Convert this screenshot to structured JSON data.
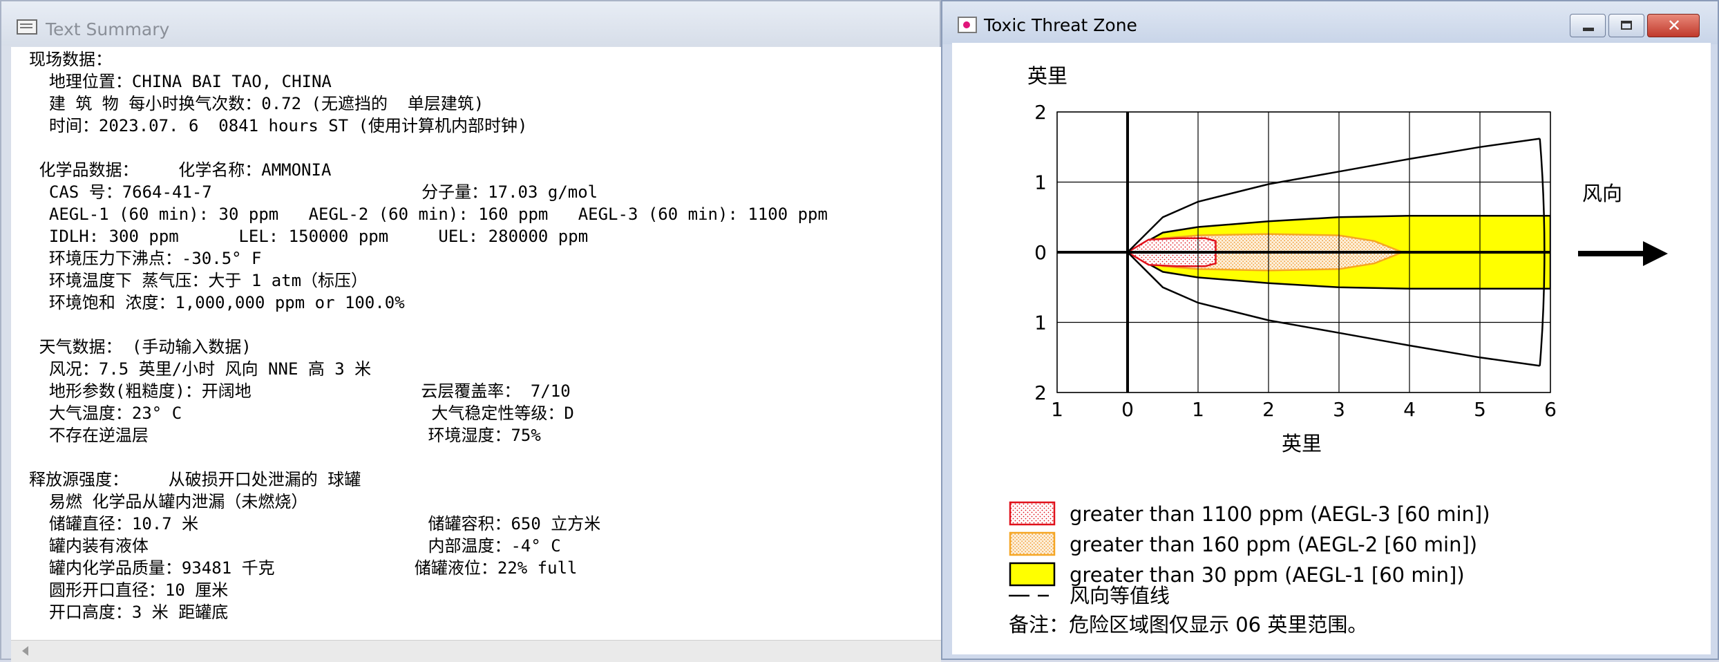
{
  "text_summary": {
    "window_title": "Text Summary",
    "lines": [
      "现场数据：",
      "  地理位置：CHINA BAI TAO, CHINA",
      "  建 筑 物 每小时换气次数：0.72 (无遮挡的  单层建筑)",
      "  时间：2023.07. 6  0841 hours ST (使用计算机内部时钟)",
      "",
      " 化学品数据：    化学名称：AMMONIA",
      "  CAS 号：7664-41-7                     分子量：17.03 g/mol",
      "  AEGL-1 (60 min): 30 ppm   AEGL-2 (60 min): 160 ppm   AEGL-3 (60 min): 1100 ppm",
      "  IDLH: 300 ppm      LEL: 150000 ppm     UEL: 280000 ppm",
      "  环境压力下沸点：-30.5° F",
      "  环境温度下 蒸气压：大于 1 atm（标压）",
      "  环境饱和 浓度：1,000,000 ppm or 100.0%",
      "",
      " 天气数据： (手动输入数据)",
      "  风况：7.5 英里/小时 风向 NNE 高 3 米",
      "  地形参数(粗糙度)：开阔地                 云层覆盖率： 7/10",
      "  大气温度：23° C                         大气稳定性等级：D",
      "  不存在逆温层                            环境湿度：75%",
      "",
      "释放源强度：    从破损开口处泄漏的 球罐",
      "  易燃 化学品从罐内泄漏（未燃烧）",
      "  储罐直径：10.7 米                       储罐容积：650 立方米",
      "  罐内装有液体                            内部温度：-4° C",
      "  罐内化学品质量：93481 千克              储罐液位：22% full",
      "  圆形开口直径：10 厘米",
      "  开口高度：3 米 距罐底"
    ]
  },
  "threat_zone": {
    "window_title": "Toxic Threat Zone",
    "close_glyph": "✕",
    "wind_label": "风向",
    "legend": [
      {
        "label": "greater than 1100 ppm (AEGL-3 [60 min])",
        "color": "#e0101a",
        "pattern": "dots"
      },
      {
        "label": "greater than 160 ppm (AEGL-2 [60 min])",
        "color": "#f5a623",
        "pattern": "dots"
      },
      {
        "label": "greater than 30 ppm (AEGL-1 [60 min])",
        "color": "#ffff00",
        "pattern": "solid"
      },
      {
        "label": "风向等值线",
        "color": "#000000",
        "pattern": "dashed-line"
      }
    ],
    "note": "备注：危险区域图仅显示 06 英里范围。"
  },
  "chart_data": {
    "type": "area",
    "ylabel": "英里",
    "xlabel": "英里",
    "x_ticks": [
      "1",
      "0",
      "1",
      "2",
      "3",
      "4",
      "5",
      "6"
    ],
    "y_ticks": [
      "2",
      "1",
      "0",
      "1",
      "2"
    ],
    "xlim": [
      -1,
      6
    ],
    "ylim": [
      -2,
      2
    ],
    "grid": true,
    "wind_direction": "+x",
    "series": [
      {
        "name": "greater than 30 ppm (AEGL-1 [60 min])",
        "color": "#ffff00",
        "x": [
          0,
          0.5,
          1,
          2,
          3,
          4,
          5,
          6
        ],
        "half_width": [
          0,
          0.28,
          0.36,
          0.44,
          0.5,
          0.52,
          0.52,
          0.52
        ]
      },
      {
        "name": "greater than 160 ppm (AEGL-2 [60 min])",
        "color": "#f5a623",
        "x": [
          0,
          0.5,
          1,
          2,
          3,
          3.5,
          3.9
        ],
        "half_width": [
          0,
          0.2,
          0.24,
          0.26,
          0.24,
          0.16,
          0
        ]
      },
      {
        "name": "greater than 1100 ppm (AEGL-3 [60 min])",
        "color": "#e0101a",
        "x": [
          0,
          0.3,
          0.7,
          1.1,
          1.25,
          1.25
        ],
        "half_width": [
          0,
          0.18,
          0.2,
          0.2,
          0.16,
          0
        ]
      },
      {
        "name": "风向等值线",
        "color": "#000000",
        "x": [
          0,
          0.5,
          1,
          2,
          3,
          4,
          5,
          5.85
        ],
        "half_width": [
          0,
          0.5,
          0.72,
          0.97,
          1.15,
          1.33,
          1.5,
          1.62
        ]
      }
    ]
  }
}
